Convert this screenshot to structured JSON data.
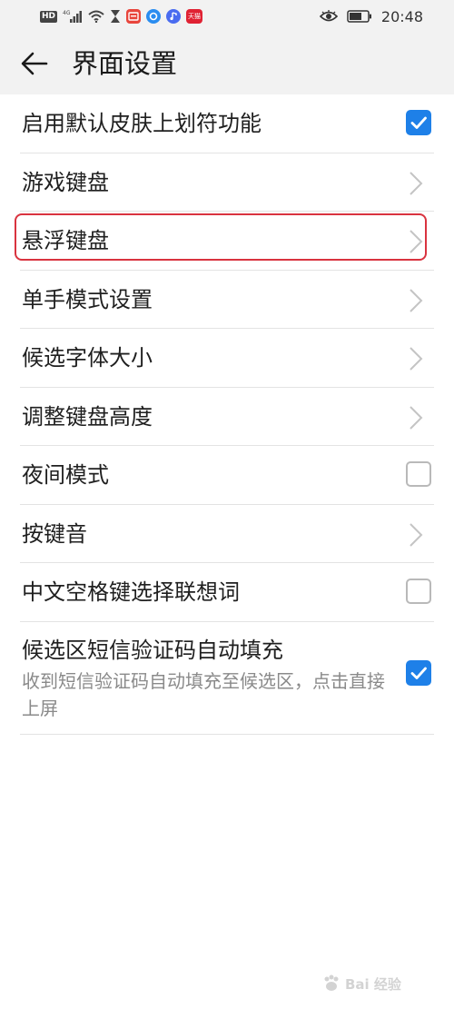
{
  "status_bar": {
    "badge": "HD",
    "network": "4G",
    "tmall_label": "天猫",
    "time": "20:48"
  },
  "header": {
    "title": "界面设置"
  },
  "settings": [
    {
      "label": "启用默认皮肤上划符功能",
      "control": "checkbox",
      "checked": true
    },
    {
      "label": "游戏键盘",
      "control": "chevron"
    },
    {
      "label": "悬浮键盘",
      "control": "chevron",
      "highlighted": true
    },
    {
      "label": "单手模式设置",
      "control": "chevron"
    },
    {
      "label": "候选字体大小",
      "control": "chevron"
    },
    {
      "label": "调整键盘高度",
      "control": "chevron"
    },
    {
      "label": "夜间模式",
      "control": "checkbox",
      "checked": false
    },
    {
      "label": "按键音",
      "control": "chevron"
    },
    {
      "label": "中文空格键选择联想词",
      "control": "checkbox",
      "checked": false
    },
    {
      "label": "候选区短信验证码自动填充",
      "description": "收到短信验证码自动填充至候选区，点击直接上屏",
      "control": "checkbox",
      "checked": true
    }
  ],
  "colors": {
    "accent": "#1e80e8",
    "highlight_border": "#d9333f",
    "header_bg": "#f2f2f2"
  },
  "watermark": {
    "text": "Bai 经验"
  }
}
